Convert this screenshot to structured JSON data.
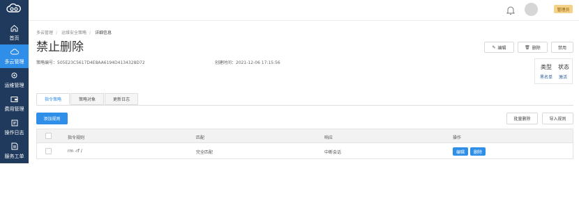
{
  "colors": {
    "sidebar": "#1f3a5c",
    "accent": "#2f8ee8",
    "badge": "#f5d28a"
  },
  "sidebar": {
    "logo_icon": "cloud-logo-icon",
    "items": [
      {
        "label": "首页",
        "icon": "home-icon"
      },
      {
        "label": "多云管理",
        "icon": "cloud-icon",
        "active": true
      },
      {
        "label": "运维管理",
        "icon": "ops-icon"
      },
      {
        "label": "费用管理",
        "icon": "wallet-icon"
      },
      {
        "label": "操作日志",
        "icon": "log-icon"
      },
      {
        "label": "服务工单",
        "icon": "ticket-icon"
      }
    ]
  },
  "topbar": {
    "role": "管理员",
    "bell_icon": "bell-icon"
  },
  "breadcrumb": [
    "多云管理",
    "运维安全策略",
    "详细信息"
  ],
  "page_title": "禁止删除",
  "meta": {
    "policy_id_label": "策略编号：",
    "policy_id": "505E23C5617D4E8AA6194D4134328D72",
    "created_label": "创建时间：",
    "created_at": "2021-12-06 17:15:56"
  },
  "actions": {
    "edit": "编辑",
    "delete": "删除",
    "disable": "禁用"
  },
  "status_box": {
    "type_label": "类型",
    "status_label": "状态",
    "type_value": "黑名单",
    "status_value": "激活"
  },
  "tabs": [
    "指令策略",
    "策略对象",
    "更新日志"
  ],
  "toolbar": {
    "add": "添加规则",
    "batch_delete": "批量删除",
    "import": "导入规则"
  },
  "table": {
    "headers": [
      "指令规则",
      "匹配",
      "响应",
      "操作"
    ],
    "rows": [
      {
        "rule": "rm -rf /",
        "match": "完全匹配",
        "response": "中断会话",
        "edit": "编辑",
        "delete": "删除"
      }
    ]
  }
}
